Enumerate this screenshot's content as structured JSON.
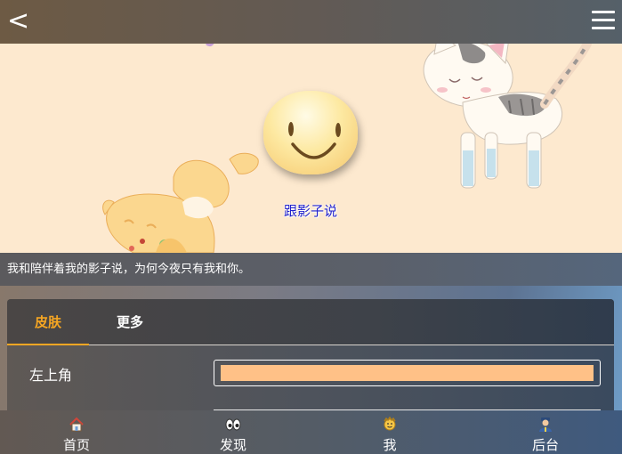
{
  "header": {
    "back_label": "<",
    "menu_icon": "hamburger-menu-icon"
  },
  "profile": {
    "name": "跟影子说"
  },
  "motto": "我和陪伴着我的影子说，为何今夜只有我和你。",
  "settings": {
    "tabs": [
      {
        "label": "皮肤",
        "active": true
      },
      {
        "label": "更多",
        "active": false
      }
    ],
    "rows": [
      {
        "label": "左上角",
        "color": "#ffc187"
      }
    ]
  },
  "nav": {
    "items": [
      {
        "label": "首页",
        "icon": "house-icon"
      },
      {
        "label": "发现",
        "icon": "eyes-icon"
      },
      {
        "label": "我",
        "icon": "smiley-face-icon"
      },
      {
        "label": "后台",
        "icon": "admin-person-icon"
      }
    ]
  },
  "colors": {
    "accent": "#f5a623",
    "banner_bg": "#fde9cf",
    "username": "#2222cc"
  }
}
